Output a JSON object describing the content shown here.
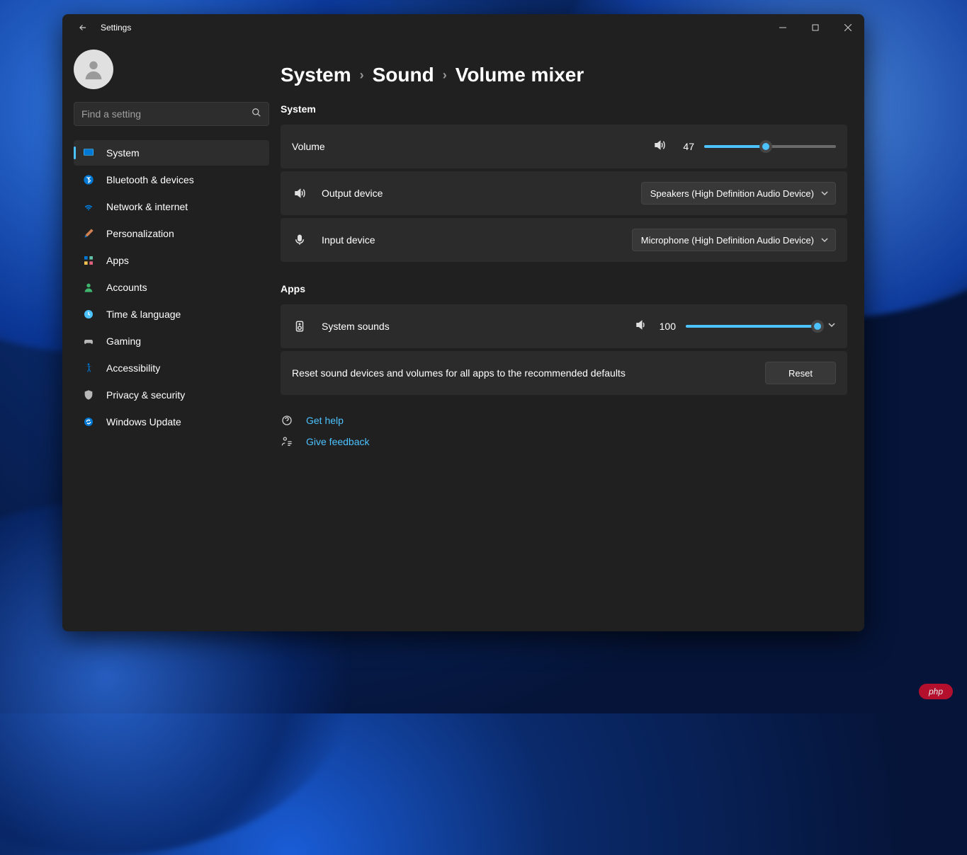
{
  "window": {
    "title": "Settings"
  },
  "search": {
    "placeholder": "Find a setting"
  },
  "sidebar": {
    "items": [
      {
        "label": "System"
      },
      {
        "label": "Bluetooth & devices"
      },
      {
        "label": "Network & internet"
      },
      {
        "label": "Personalization"
      },
      {
        "label": "Apps"
      },
      {
        "label": "Accounts"
      },
      {
        "label": "Time & language"
      },
      {
        "label": "Gaming"
      },
      {
        "label": "Accessibility"
      },
      {
        "label": "Privacy & security"
      },
      {
        "label": "Windows Update"
      }
    ]
  },
  "breadcrumb": {
    "level1": "System",
    "level2": "Sound",
    "current": "Volume mixer"
  },
  "sections": {
    "system_label": "System",
    "apps_label": "Apps"
  },
  "volume": {
    "label": "Volume",
    "value": "47",
    "percent": 47
  },
  "output": {
    "label": "Output device",
    "selected": "Speakers (High Definition Audio Device)"
  },
  "input": {
    "label": "Input device",
    "selected": "Microphone (High Definition Audio Device)"
  },
  "system_sounds": {
    "label": "System sounds",
    "value": "100",
    "percent": 100
  },
  "reset": {
    "description": "Reset sound devices and volumes for all apps to the recommended defaults",
    "button": "Reset"
  },
  "help": {
    "get_help": "Get help",
    "give_feedback": "Give feedback"
  },
  "watermark": "php"
}
